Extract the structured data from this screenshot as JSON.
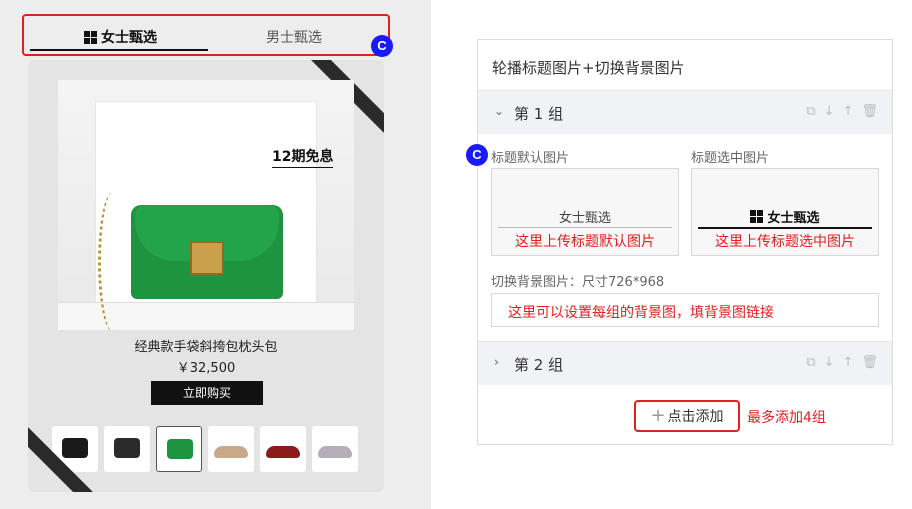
{
  "preview": {
    "tabs": [
      {
        "label": "女士甄选",
        "active": true
      },
      {
        "label": "男士甄选",
        "active": false
      }
    ],
    "badge_letter": "C",
    "promo": "12期免息",
    "product_name": "经典款手袋斜挎包枕头包",
    "price": "￥32,500",
    "buy_label": "立即购买",
    "thumbnails": [
      {
        "name": "black-bag",
        "color": "#1a1a1a",
        "kind": "bag",
        "selected": false
      },
      {
        "name": "black-bag-2",
        "color": "#2b2b2b",
        "kind": "bag",
        "selected": false
      },
      {
        "name": "green-bag",
        "color": "#1e9440",
        "kind": "bag",
        "selected": true
      },
      {
        "name": "nude-heel",
        "color": "#c7a98a",
        "kind": "shoe",
        "selected": false
      },
      {
        "name": "red-heel",
        "color": "#8c1b1b",
        "kind": "shoe",
        "selected": false
      },
      {
        "name": "grey-heel",
        "color": "#b5aeb8",
        "kind": "shoe",
        "selected": false
      }
    ]
  },
  "panel": {
    "title": "轮播标题图片+切换背景图片",
    "group1": {
      "title": "第 1 组",
      "default_label": "标题默认图片",
      "selected_label": "标题选中图片",
      "default_preview": "女士甄选",
      "selected_preview": "女士甄选",
      "default_hint": "这里上传标题默认图片",
      "selected_hint": "这里上传标题选中图片",
      "bg_label": "切换背景图片：尺寸726*968",
      "bg_hint": "这里可以设置每组的背景图，填背景图链接"
    },
    "group2": {
      "title": "第 2 组"
    },
    "add_label": "点击添加",
    "add_note": "最多添加4组"
  },
  "colors": {
    "accent_red": "#e02020",
    "badge_blue": "#1a1aff"
  }
}
